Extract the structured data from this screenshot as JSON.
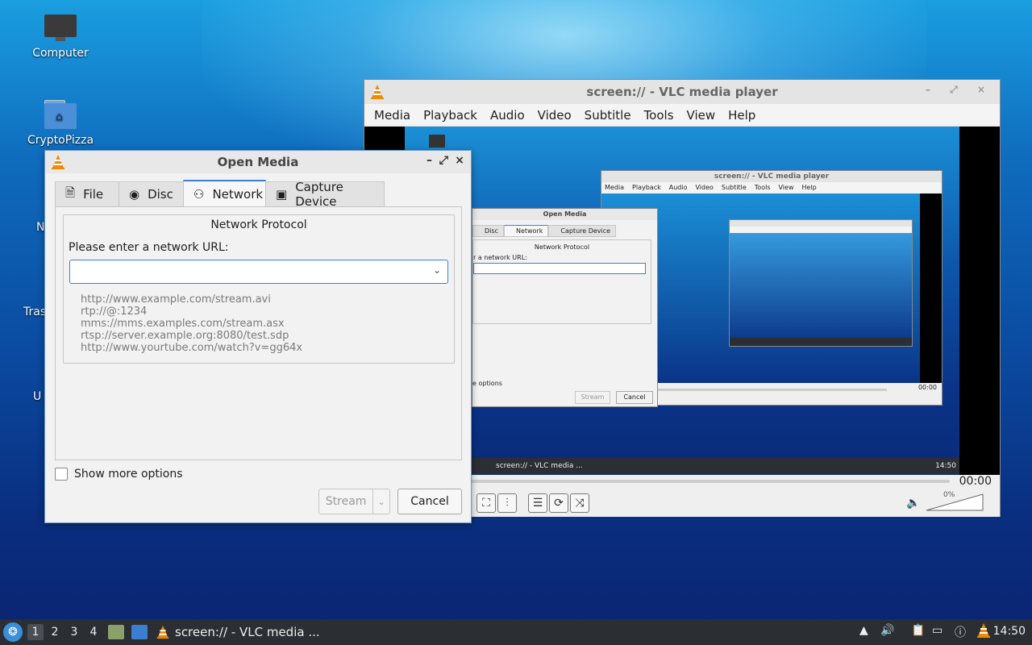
{
  "desktop": {
    "icons": [
      {
        "label": "Computer"
      },
      {
        "label": "CryptoPizza"
      }
    ],
    "partial_labels": [
      "N",
      "Tras",
      "U"
    ]
  },
  "vlc": {
    "title": "screen:// - VLC media player",
    "menu": [
      "Media",
      "Playback",
      "Audio",
      "Video",
      "Subtitle",
      "Tools",
      "View",
      "Help"
    ],
    "time": "00:00",
    "volume": "0%",
    "nested_title": "screen:// - VLC media player",
    "nested_menu": [
      "Media",
      "Playback",
      "Audio",
      "Video",
      "Subtitle",
      "Tools",
      "View",
      "Help"
    ],
    "nested_time": "00:00",
    "nested_dialog_title": "Open Media",
    "nested_tabs": [
      "Disc",
      "Network",
      "Capture Device"
    ],
    "nested_protocol": "Network Protocol",
    "nested_url_label": "r a network URL:",
    "nested_more": "e options",
    "nested_stream": "Stream",
    "nested_cancel": "Cancel",
    "nested_taskbar_task": "screen:// - VLC media ...",
    "nested_clock": "14:50"
  },
  "dialog": {
    "title": "Open Media",
    "tabs": [
      {
        "label": "File",
        "icon": "file-icon"
      },
      {
        "label": "Disc",
        "icon": "disc-icon"
      },
      {
        "label": "Network",
        "icon": "network-icon"
      },
      {
        "label": "Capture Device",
        "icon": "capture-device-icon"
      }
    ],
    "group_title": "Network Protocol",
    "url_label": "Please enter a network URL:",
    "url_value": "",
    "examples": [
      "http://www.example.com/stream.avi",
      "rtp://@:1234",
      "mms://mms.examples.com/stream.asx",
      "rtsp://server.example.org:8080/test.sdp",
      "http://www.yourtube.com/watch?v=gg64x"
    ],
    "show_more_options": "Show more options",
    "stream_button": "Stream",
    "cancel_button": "Cancel"
  },
  "taskbar": {
    "workspaces": [
      "1",
      "2",
      "3",
      "4"
    ],
    "task_label": "screen:// - VLC media ...",
    "clock": "14:50"
  },
  "colors": {
    "accent": "#3a7fd5",
    "vlc_orange": "#f08a00"
  }
}
